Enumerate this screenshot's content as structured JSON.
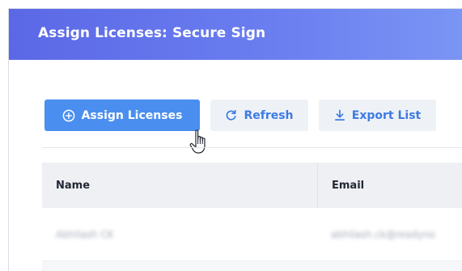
{
  "header": {
    "title": "Assign Licenses: Secure Sign",
    "gradient_start": "#5b68e6",
    "gradient_end": "#7a95f4"
  },
  "toolbar": {
    "assign_label": "Assign Licenses",
    "assign_icon": "plus-circle-icon",
    "refresh_label": "Refresh",
    "refresh_icon": "refresh-icon",
    "export_label": "Export List",
    "export_icon": "download-icon",
    "primary_color": "#4a8ff0",
    "secondary_text_color": "#3d7be3"
  },
  "table": {
    "columns": [
      "Name",
      "Email"
    ],
    "rows": [
      {
        "name": "Abhilash CK",
        "email": "abhilash.ck@readyno"
      }
    ]
  },
  "cursor": {
    "icon": "hand-pointer-icon"
  }
}
